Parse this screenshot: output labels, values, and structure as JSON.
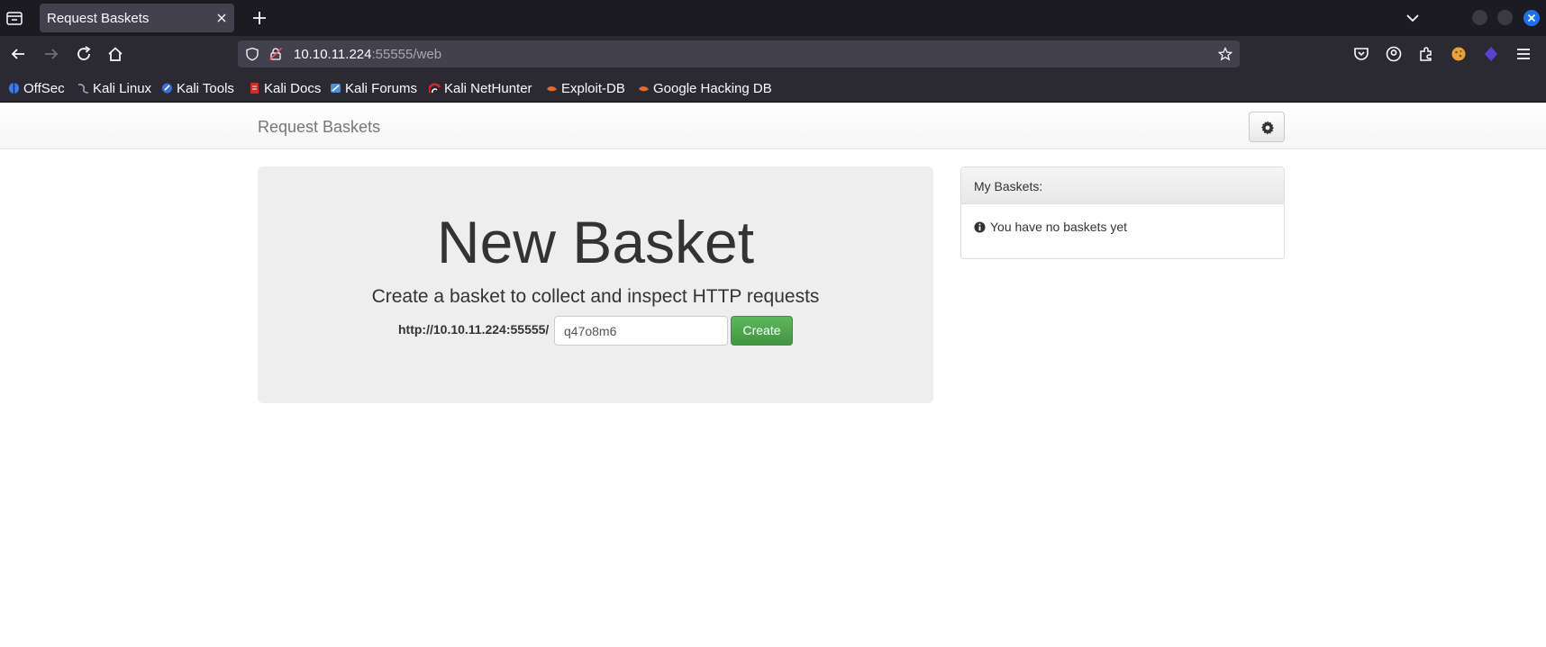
{
  "browser": {
    "tab_title": "Request Baskets",
    "url_host": "10.10.11.224",
    "url_rest": ":55555/web",
    "bookmarks": [
      {
        "label": "OffSec",
        "icon": "offsec-icon",
        "color": "#3c7cf0"
      },
      {
        "label": "Kali Linux",
        "icon": "kali-dragon-icon",
        "color": "#9aa6b8"
      },
      {
        "label": "Kali Tools",
        "icon": "kali-tools-icon",
        "color": "#3c6fd8"
      },
      {
        "label": "Kali Docs",
        "icon": "kali-docs-icon",
        "color": "#d62828"
      },
      {
        "label": "Kali Forums",
        "icon": "kali-forums-icon",
        "color": "#4a8fe0"
      },
      {
        "label": "Kali NetHunter",
        "icon": "nethunter-icon",
        "color": "#d62828"
      },
      {
        "label": "Exploit-DB",
        "icon": "exploit-db-icon",
        "color": "#e8692a"
      },
      {
        "label": "Google Hacking DB",
        "icon": "ghdb-icon",
        "color": "#e8692a"
      }
    ]
  },
  "app": {
    "brand": "Request Baskets",
    "hero": {
      "title": "New Basket",
      "subtitle": "Create a basket to collect and inspect HTTP requests",
      "base_url": "http://10.10.11.224:55555/",
      "basket_name": "q47o8m6",
      "create_label": "Create"
    },
    "baskets_panel": {
      "title": "My Baskets:",
      "empty_message": "You have no baskets yet"
    }
  },
  "colors": {
    "accent_green": "#5cb85c",
    "firefox_dark": "#2b2a33"
  }
}
